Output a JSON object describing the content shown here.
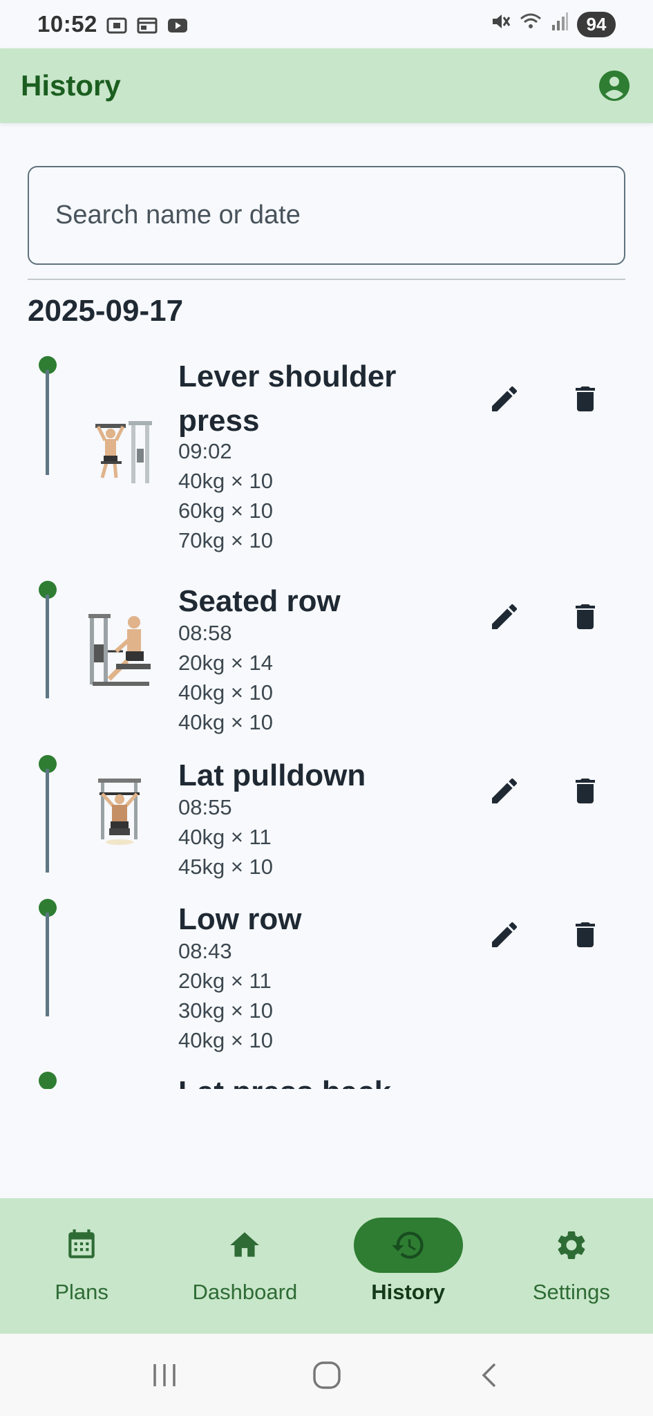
{
  "status_bar": {
    "time": "10:52",
    "battery": "94",
    "icons": [
      "screenshot-icon",
      "calendar-card-icon",
      "youtube-icon",
      "mute-icon",
      "wifi-icon",
      "signal-icon"
    ]
  },
  "app_bar": {
    "title": "History",
    "account_icon": "account-circle-icon"
  },
  "search": {
    "placeholder": "Search name or date",
    "value": ""
  },
  "history": {
    "date": "2025-09-17",
    "entries": [
      {
        "name": "Lever shoulder press",
        "time": "09:02",
        "sets": [
          "40kg × 10",
          "60kg × 10",
          "70kg × 10"
        ],
        "image": "shoulder-press-machine"
      },
      {
        "name": "Seated row",
        "time": "08:58",
        "sets": [
          "20kg × 14",
          "40kg × 10",
          "40kg × 10"
        ],
        "image": "seated-row-machine"
      },
      {
        "name": "Lat pulldown",
        "time": "08:55",
        "sets": [
          "40kg × 11",
          "45kg × 10"
        ],
        "image": "lat-pulldown-machine"
      },
      {
        "name": "Low row",
        "time": "08:43",
        "sets": [
          "20kg × 11",
          "30kg × 10",
          "40kg × 10"
        ],
        "image": ""
      },
      {
        "name": "Lat press back",
        "time": "",
        "sets": [],
        "image": ""
      }
    ]
  },
  "bottom_nav": {
    "items": [
      {
        "label": "Plans",
        "icon": "calendar-icon"
      },
      {
        "label": "Dashboard",
        "icon": "home-icon"
      },
      {
        "label": "History",
        "icon": "history-icon",
        "active": true
      },
      {
        "label": "Settings",
        "icon": "gear-icon"
      }
    ]
  },
  "colors": {
    "accent": "#2e7d32",
    "app_bar_bg": "#c8e6c9",
    "title_green": "#1b5e20",
    "timeline_line": "#5d7785",
    "background": "#f7f9fc"
  }
}
